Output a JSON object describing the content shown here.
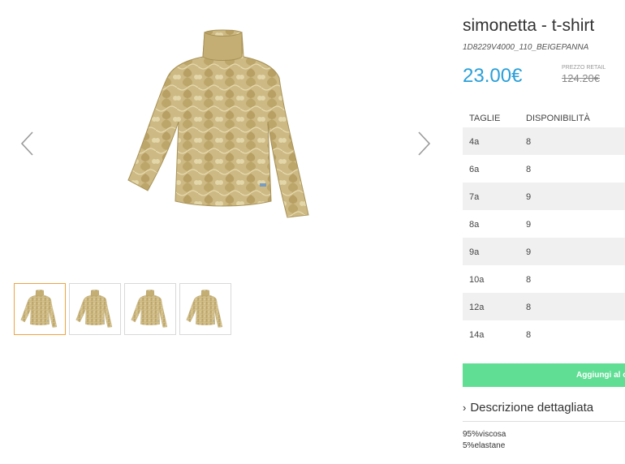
{
  "product": {
    "title": "simonetta - t-shirt",
    "sku": "1D8229V4000_110_BEIGEPANNA",
    "price": "23.00€",
    "retail_label": "PREZZO RETAIL",
    "retail_price": "124.20€"
  },
  "gallery": {
    "main_image": "turtleneck-shirt-image",
    "thumbnails": [
      "turtleneck-shirt-thumb",
      "turtleneck-shirt-thumb",
      "turtleneck-shirt-thumb",
      "turtleneck-shirt-thumb"
    ],
    "active_thumbnail": 0,
    "prev_icon": "chevron-left-icon",
    "next_icon": "chevron-right-icon"
  },
  "sizes": {
    "headers": [
      "TAGLIE",
      "DISPONIBILITÀ"
    ],
    "rows": [
      {
        "size": "4a",
        "qty": "8"
      },
      {
        "size": "6a",
        "qty": "8"
      },
      {
        "size": "7a",
        "qty": "9"
      },
      {
        "size": "8a",
        "qty": "9"
      },
      {
        "size": "9a",
        "qty": "9"
      },
      {
        "size": "10a",
        "qty": "8"
      },
      {
        "size": "12a",
        "qty": "8"
      },
      {
        "size": "14a",
        "qty": "8"
      }
    ]
  },
  "actions": {
    "add_label": "Aggiungi al c"
  },
  "description": {
    "heading": "Descrizione dettagliata",
    "lines": [
      "95%viscosa",
      "5%elastane"
    ]
  },
  "colors": {
    "price": "#2a9fd8",
    "button": "#5fde94",
    "active_thumb": "#f0a244",
    "row_stripe": "#f0f0f0",
    "garment": "#c9b47a"
  }
}
